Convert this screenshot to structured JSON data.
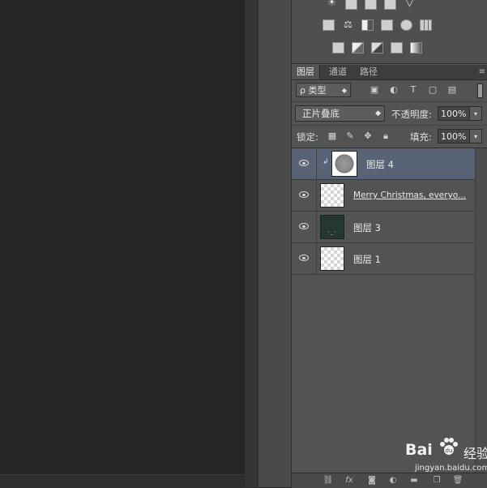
{
  "adjustments": {
    "row1": [
      "brightness-icon",
      "levels-icon",
      "curves-icon",
      "exposure-icon",
      "vibrance-icon"
    ],
    "row2": [
      "hue-saturation-icon",
      "color-balance-icon",
      "black-white-icon",
      "photo-filter-icon",
      "channel-mixer-icon",
      "color-lookup-icon"
    ],
    "row3": [
      "invert-icon",
      "posterize-icon",
      "threshold-icon",
      "selective-color-icon",
      "gradient-map-icon"
    ]
  },
  "tabs": [
    "图层",
    "通道",
    "路径"
  ],
  "filter": {
    "kind_label": "ρ 类型"
  },
  "blend": {
    "mode": "正片叠底",
    "opacity_label": "不透明度:",
    "opacity_value": "100%"
  },
  "lock": {
    "label": "锁定:",
    "fill_label": "填充:",
    "fill_value": "100%"
  },
  "layers": [
    {
      "name": "图层 4",
      "selected": true,
      "clipped": true,
      "thumb": "noise"
    },
    {
      "name": "Merry Christmas, everyo...",
      "selected": false,
      "clipped": false,
      "thumb": "checker",
      "is_text": true
    },
    {
      "name": "图层 3",
      "selected": false,
      "clipped": false,
      "thumb": "dark"
    },
    {
      "name": "图层 1",
      "selected": false,
      "clipped": false,
      "thumb": "checker"
    }
  ],
  "bottom_bar": [
    "link-icon",
    "fx-icon",
    "mask-icon",
    "adjustment-layer-icon",
    "folder-icon",
    "new-layer-icon",
    "trash-icon"
  ],
  "watermark": {
    "logo": "Bai",
    "cn": "经验",
    "url": "jingyan.baidu.com"
  }
}
